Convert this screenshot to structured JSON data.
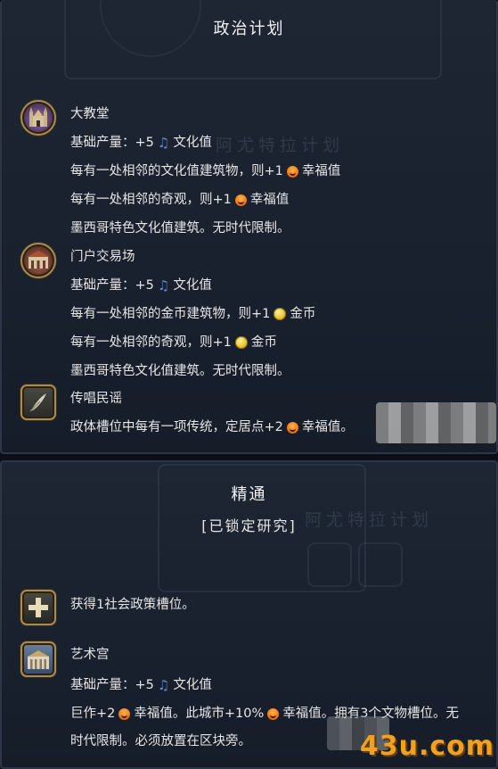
{
  "panel1": {
    "title": "政治计划",
    "ghost_text": "阿尤特拉计划",
    "entries": [
      {
        "icon": "cathedral-icon",
        "name": "大教堂",
        "base_label": "基础产量：",
        "base_value": "+5",
        "base_unit": "文化值",
        "line2_pre": "每有一处相邻的文化值建筑物，则+1",
        "line2_post": "幸福值",
        "line3_pre": "每有一处相邻的奇观，则+1",
        "line3_post": "幸福值",
        "line4": "墨西哥特色文化值建筑。无时代限制。"
      },
      {
        "icon": "portal-market-icon",
        "name": "门户交易场",
        "base_label": "基础产量：",
        "base_value": "+5",
        "base_unit": "文化值",
        "line2_pre": "每有一处相邻的金币建筑物，则+1",
        "line2_post": "金币",
        "line3_pre": "每有一处相邻的奇观，则+1",
        "line3_post": "金币",
        "line4": "墨西哥特色文化值建筑。无时代限制。"
      },
      {
        "icon": "quill-icon",
        "name": "传唱民谣",
        "line1_pre": "政体槽位中每有一项传统，定居点+2",
        "line1_post": "幸福值。"
      }
    ]
  },
  "panel2": {
    "title": "精通",
    "subtitle": "[已锁定研究]",
    "ghost_text": "阿尤特拉计划",
    "entries": [
      {
        "icon": "plus-slot-icon",
        "text": "获得1社会政策槽位。"
      },
      {
        "icon": "palace-of-arts-icon",
        "name": "艺术宫",
        "base_label": "基础产量：",
        "base_value": "+5",
        "base_unit": "文化值",
        "line2_a": "巨作+2",
        "line2_b": "幸福值。此城市+10%",
        "line2_c": "幸福值。拥有3个文物槽位。无",
        "line3": "时代限制。必须放置在区块旁。"
      }
    ]
  },
  "watermark": "43u.com",
  "colors": {
    "panel_bg": "#1c2432",
    "border": "#2c3646",
    "culture": "#6d7ed8",
    "happiness": "#f07a1a",
    "gold": "#e9c230",
    "icon_frame": "#a88c52"
  }
}
